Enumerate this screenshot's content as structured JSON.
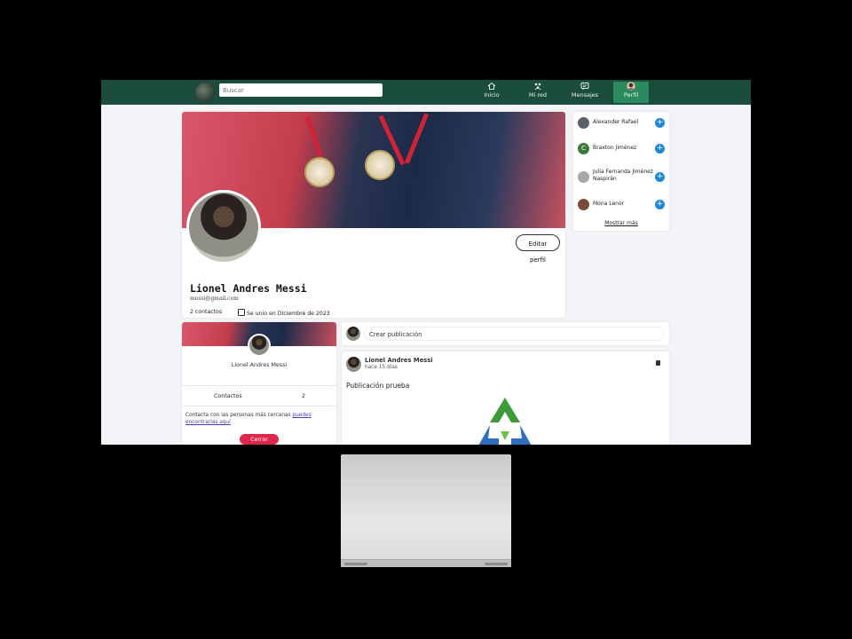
{
  "navbar": {
    "search_placeholder": "Buscar",
    "items": [
      {
        "label": "Inicio",
        "icon": "home-icon"
      },
      {
        "label": "Mi red",
        "icon": "network-icon"
      },
      {
        "label": "Mensajes",
        "icon": "message-icon"
      },
      {
        "label": "Perfil",
        "icon": "avatar-icon",
        "active": true
      }
    ]
  },
  "profile": {
    "name": "Lionel Andres Messi",
    "email": "messi@gmail.com",
    "contacts": "2 contactos",
    "joined": "Se unio en Diciembre de 2023",
    "edit_label": "Editar perfil"
  },
  "suggestions": {
    "items": [
      {
        "name": "Alexander Rafael"
      },
      {
        "name": "Braxton Jiménez",
        "initial": "C"
      },
      {
        "name": "Julia Fernanda Jiménez Naspirán"
      },
      {
        "name": "Mona Lenor"
      }
    ],
    "more_label": "Mostrar más"
  },
  "mini_card": {
    "name": "Lionel Andres Messi",
    "contacts_label": "Contactos",
    "contacts_count": "2",
    "text": "Contacta con las personas más cercanas ",
    "link": "puedes encontrarlas aquí",
    "logout_label": "Cerrar sesión"
  },
  "create_post": {
    "placeholder": "Crear publicación"
  },
  "post": {
    "author": "Lionel Andres Messi",
    "time": "hace 15 días",
    "text": "Publicación prueba"
  },
  "colors": {
    "navbar": "#1b4d3e",
    "active_nav": "#2b8a5f",
    "add_button": "#1e88d8",
    "logout": "#e0264a"
  }
}
